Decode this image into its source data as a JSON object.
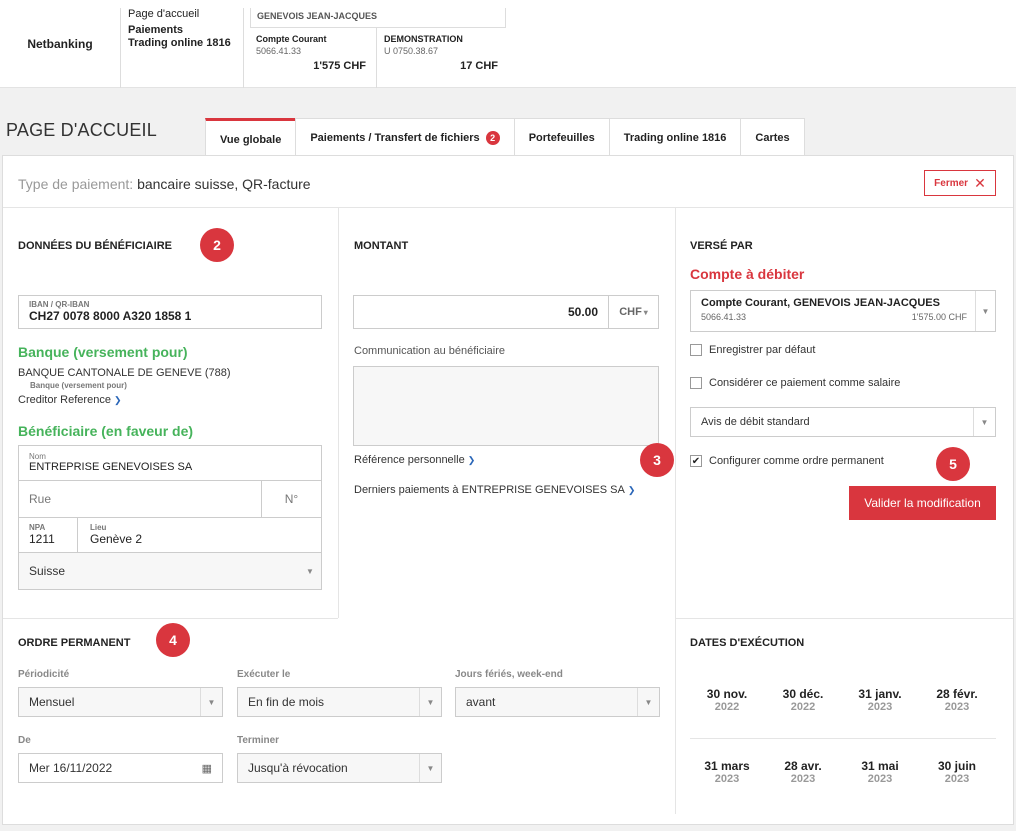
{
  "header": {
    "brand": "Netbanking",
    "nav": {
      "home": "Page d'accueil",
      "payments": "Paiements",
      "trading": "Trading online 1816"
    },
    "owner": "GENEVOIS JEAN-JACQUES",
    "accounts": [
      {
        "name": "Compte Courant",
        "number": "5066.41.33",
        "balance": "1'575 CHF"
      },
      {
        "name": "DEMONSTRATION",
        "number": "U 0750.38.67",
        "balance": "17 CHF"
      }
    ]
  },
  "page": {
    "title": "PAGE D'ACCUEIL"
  },
  "tabs": [
    {
      "label": "Vue globale"
    },
    {
      "label": "Paiements / Transfert de fichiers",
      "badge": "2"
    },
    {
      "label": "Portefeuilles"
    },
    {
      "label": "Trading online 1816"
    },
    {
      "label": "Cartes"
    }
  ],
  "payment": {
    "type_label": "Type de paiement:",
    "type_value": "bancaire suisse, QR-facture",
    "close_label": "Fermer"
  },
  "beneficiary": {
    "section": "DONNÉES DU BÉNÉFICIAIRE",
    "iban_label": "IBAN / QR-IBAN",
    "iban": "CH27 0078 8000 A320 1858 1",
    "bank_title": "Banque (versement pour)",
    "bank_name": "BANQUE CANTONALE DE GENEVE (788)",
    "bank_sub": "Banque (versement pour)",
    "creditor_ref": "Creditor Reference",
    "benef_title": "Bénéficiaire (en faveur de)",
    "name_label": "Nom",
    "name": "ENTREPRISE GENEVOISES SA",
    "street_ph": "Rue",
    "number_ph": "N°",
    "npa_label": "NPA",
    "npa": "1211",
    "city_label": "Lieu",
    "city": "Genève 2",
    "country": "Suisse"
  },
  "amount": {
    "section": "MONTANT",
    "value": "50.00",
    "currency": "CHF",
    "communication_label": "Communication au bénéficiaire",
    "personal_ref": "Référence personnelle",
    "last_payments": "Derniers paiements à ENTREPRISE GENEVOISES SA"
  },
  "paid_by": {
    "section": "VERSÉ PAR",
    "debit_title": "Compte à débiter",
    "account_name": "Compte Courant, GENEVOIS JEAN-JACQUES",
    "account_number": "5066.41.33",
    "account_balance": "1'575.00 CHF",
    "save_default": "Enregistrer par défaut",
    "salary": "Considérer ce paiement comme salaire",
    "debit_notice": "Avis de débit standard",
    "standing_order": "Configurer comme ordre permanent",
    "standing_checked": true,
    "validate": "Valider la modification"
  },
  "markers": {
    "m2": "2",
    "m3": "3",
    "m4": "4",
    "m5": "5"
  },
  "standing_order": {
    "section": "ORDRE PERMANENT",
    "period_label": "Périodicité",
    "period": "Mensuel",
    "execute_label": "Exécuter le",
    "execute": "En fin de mois",
    "holidays_label": "Jours fériés, week-end",
    "holidays": "avant",
    "from_label": "De",
    "from": "Mer  16/11/2022",
    "end_label": "Terminer",
    "end": "Jusqu'à révocation"
  },
  "execution_dates": {
    "section": "DATES D'EXÉCUTION",
    "dates": [
      {
        "d": "30 nov.",
        "y": "2022"
      },
      {
        "d": "30 déc.",
        "y": "2022"
      },
      {
        "d": "31 janv.",
        "y": "2023"
      },
      {
        "d": "28 févr.",
        "y": "2023"
      },
      {
        "d": "31 mars",
        "y": "2023"
      },
      {
        "d": "28 avr.",
        "y": "2023"
      },
      {
        "d": "31 mai",
        "y": "2023"
      },
      {
        "d": "30 juin",
        "y": "2023"
      }
    ]
  }
}
